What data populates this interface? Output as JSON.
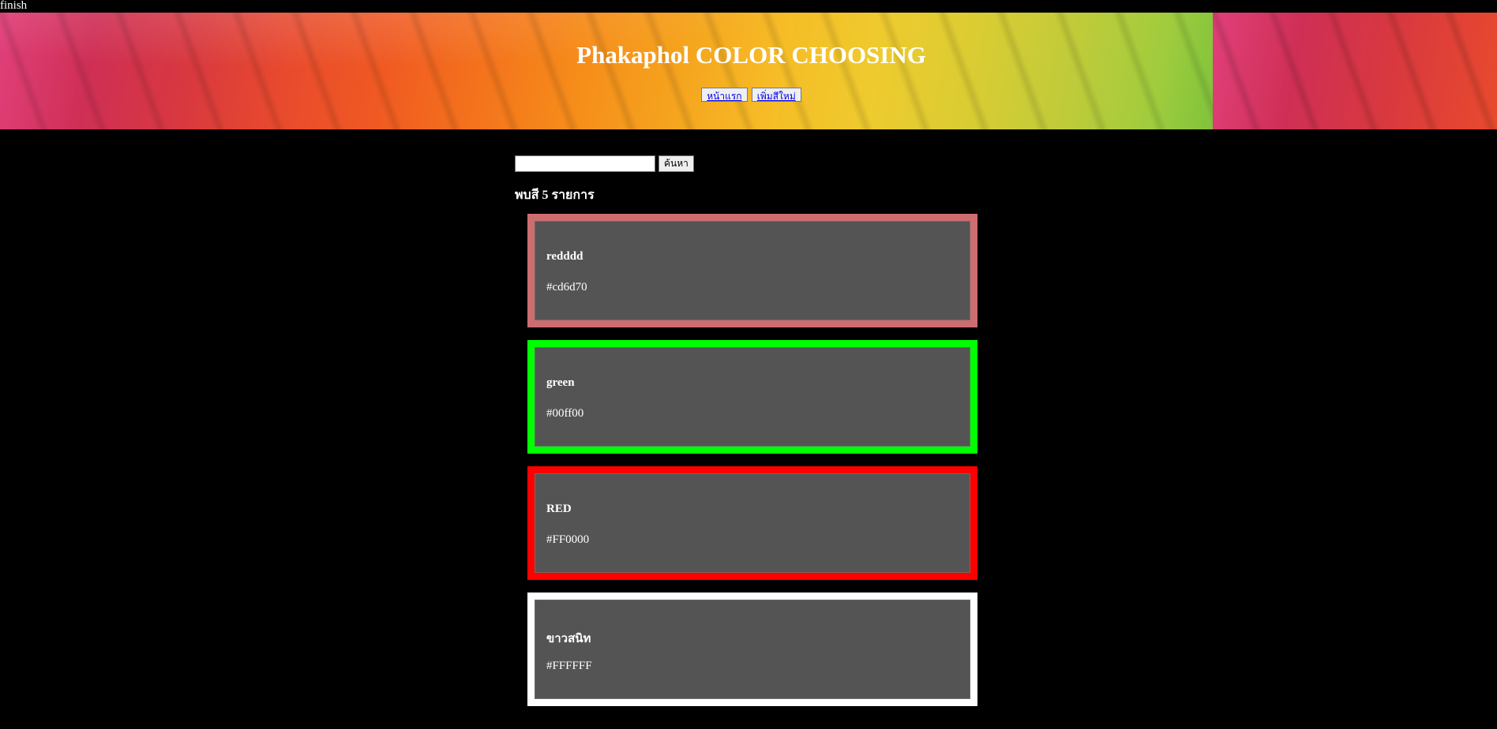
{
  "status_text": "finish",
  "header": {
    "title": "Phakaphol COLOR CHOOSING",
    "nav": [
      {
        "label": "หน้าแรก"
      },
      {
        "label": "เพิ่มสีใหม่"
      }
    ]
  },
  "search": {
    "value": "",
    "placeholder": "",
    "button_label": "ค้นหา"
  },
  "results": {
    "summary": "พบสี 5 รายการ",
    "items": [
      {
        "name": "redddd",
        "hex": "#cd6d70",
        "border_color": "#cd6d70"
      },
      {
        "name": "green",
        "hex": "#00ff00",
        "border_color": "#00ff00"
      },
      {
        "name": "RED",
        "hex": "#FF0000",
        "border_color": "#FF0000"
      },
      {
        "name": "ขาวสนิท",
        "hex": "#FFFFFF",
        "border_color": "#FFFFFF"
      }
    ]
  }
}
